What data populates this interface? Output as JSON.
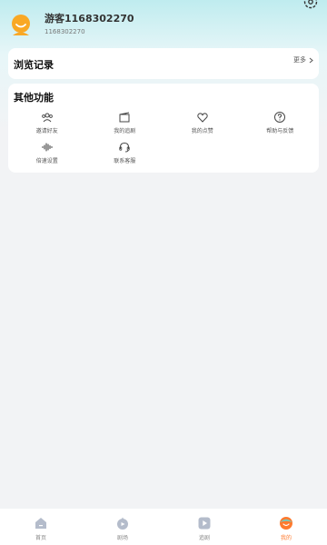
{
  "profile": {
    "name": "游客1168302270",
    "id": "1168302270"
  },
  "history": {
    "title": "浏览记录",
    "more": "更多"
  },
  "features": {
    "title": "其他功能",
    "items": [
      {
        "label": "邀请好友",
        "icon": "invite-friends-icon"
      },
      {
        "label": "我的追剧",
        "icon": "my-series-icon"
      },
      {
        "label": "我的点赞",
        "icon": "heart-icon"
      },
      {
        "label": "帮助与反馈",
        "icon": "help-icon"
      },
      {
        "label": "倍速设置",
        "icon": "speed-icon"
      },
      {
        "label": "联系客服",
        "icon": "headset-icon"
      }
    ]
  },
  "tabbar": {
    "items": [
      {
        "label": "首页",
        "icon": "home-icon",
        "active": false
      },
      {
        "label": "剧场",
        "icon": "theater-icon",
        "active": false
      },
      {
        "label": "追剧",
        "icon": "play-icon",
        "active": false
      },
      {
        "label": "我的",
        "icon": "profile-icon",
        "active": true
      }
    ]
  },
  "colors": {
    "accent": "#ff7a2e",
    "avatar": "#f9a825",
    "header_gradient_top": "#bfecef"
  }
}
